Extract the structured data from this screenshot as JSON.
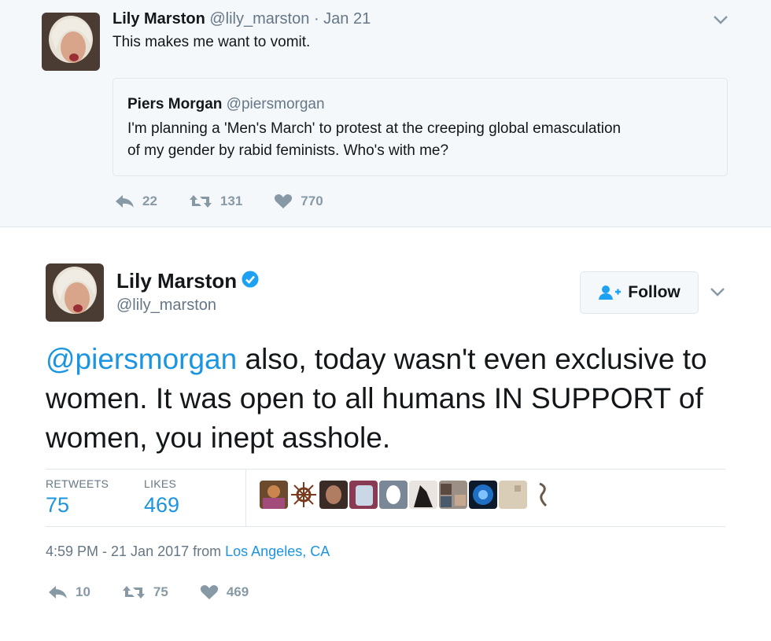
{
  "quote_tweet": {
    "author_name": "Lily Marston",
    "author_handle": "@lily_marston",
    "separator": "·",
    "date": "Jan 21",
    "text": "This makes me want to vomit.",
    "quoted": {
      "author_name": "Piers Morgan",
      "author_handle": "@piersmorgan",
      "line1": "I'm planning a 'Men's March' to protest at the creeping global emasculation",
      "line2": "of my gender by rabid feminists. Who's with me?"
    },
    "replies": "22",
    "retweets": "131",
    "likes": "770"
  },
  "main_tweet": {
    "author_name": "Lily Marston",
    "author_handle": "@lily_marston",
    "verified": true,
    "follow_label": "Follow",
    "mention": "@piersmorgan",
    "text": " also, today wasn't even exclusive to women. It was open to all humans IN SUPPORT of women, you inept asshole.",
    "retweets_label": "RETWEETS",
    "retweets_count": "75",
    "likes_label": "LIKES",
    "likes_count": "469",
    "timestamp": "4:59 PM - 21 Jan 2017 from ",
    "location": "Los Angeles, CA",
    "replies": "10",
    "retweets": "75",
    "likes": "469"
  },
  "icons": [
    "reply-icon",
    "retweet-icon",
    "heart-icon",
    "chevron-down-icon",
    "verified-badge-icon",
    "follow-person-icon"
  ],
  "colors": {
    "link": "#1b95e0",
    "muted": "#657786",
    "icon": "#8899a6",
    "top_bg": "#f5f8fa",
    "border": "#e1e8ed"
  }
}
